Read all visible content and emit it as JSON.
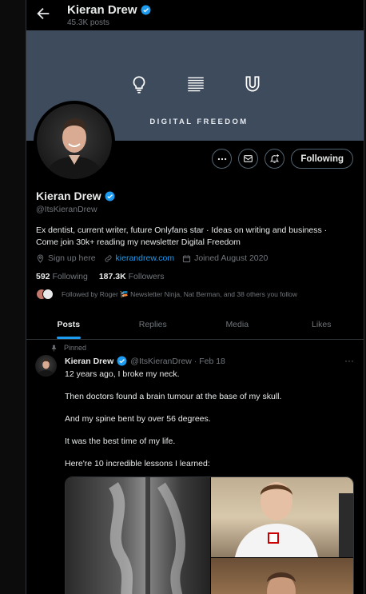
{
  "header": {
    "title": "Kieran Drew",
    "posts_count": "45.3K posts"
  },
  "banner": {
    "text": "DIGITAL FREEDOM",
    "icons": [
      "lightbulb-icon",
      "document-lines-icon",
      "magnet-icon"
    ],
    "color": "#3e4b5c"
  },
  "profile": {
    "name": "Kieran Drew",
    "handle": "@ItsKieranDrew",
    "bio_line1": "Ex dentist, current writer, future Onlyfans star · Ideas on writing and business ·",
    "bio_line2": "Come join 30k+ reading my newsletter Digital Freedom",
    "location": "Sign up here",
    "website": "kierandrew.com",
    "joined": "Joined August 2020",
    "following_count": "592",
    "following_label": "Following",
    "followers_count": "187.3K",
    "followers_label": "Followers",
    "followed_by": "Followed by Roger 🎏 Newsletter Ninja, Nat Berman, and 38 others you follow"
  },
  "actions": {
    "follow_label": "Following"
  },
  "tabs": [
    {
      "label": "Posts",
      "active": true
    },
    {
      "label": "Replies",
      "active": false
    },
    {
      "label": "Media",
      "active": false
    },
    {
      "label": "Likes",
      "active": false
    }
  ],
  "post": {
    "pinned_label": "Pinned",
    "author": "Kieran Drew",
    "handle_date": "@ItsKieranDrew · Feb 18",
    "lines": [
      "12 years ago, I broke my neck.",
      "Then doctors found a brain tumour at the base of my skull.",
      "And my spine bent by over 56 degrees.",
      "It was the best time of my life.",
      "Here're 10 incredible lessons I learned:"
    ]
  },
  "colors": {
    "accent": "#1d9bf0",
    "background": "#000000",
    "muted": "#71767b"
  }
}
